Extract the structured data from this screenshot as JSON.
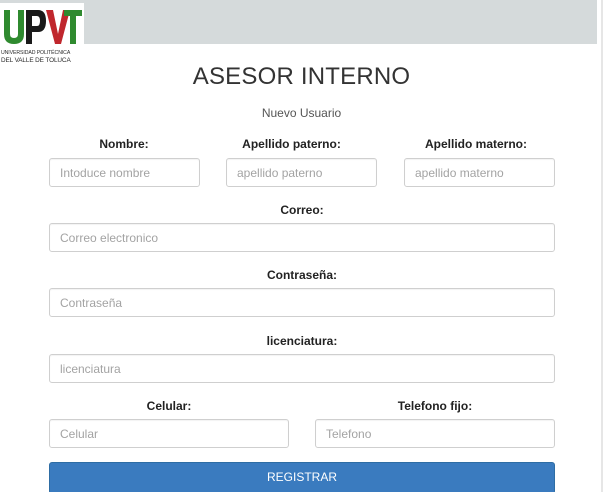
{
  "logo": {
    "line1": "UNIVERSIDAD POLITÉCNICA",
    "line2": "DEL VALLE DE TOLUCA",
    "colors": {
      "green": "#2f8a2f",
      "red": "#c0272d",
      "dark": "#1a1a1a"
    }
  },
  "header": {
    "title": "ASESOR INTERNO",
    "subtitle": "Nuevo Usuario"
  },
  "form": {
    "nombre": {
      "label": "Nombre:",
      "placeholder": "Intoduce nombre"
    },
    "apellido_paterno": {
      "label": "Apellido paterno:",
      "placeholder": "apellido paterno"
    },
    "apellido_materno": {
      "label": "Apellido materno:",
      "placeholder": "apellido materno"
    },
    "correo": {
      "label": "Correo:",
      "placeholder": "Correo electronico"
    },
    "contrasena": {
      "label": "Contraseña:",
      "placeholder": "Contraseña"
    },
    "licenciatura": {
      "label": "licenciatura:",
      "placeholder": "licenciatura"
    },
    "celular": {
      "label": "Celular:",
      "placeholder": "Celular"
    },
    "telefono_fijo": {
      "label": "Telefono fijo:",
      "placeholder": "Telefono"
    },
    "submit_label": "REGISTRAR"
  },
  "colors": {
    "topbar": "#d5dadb",
    "button": "#3a7bbf"
  }
}
